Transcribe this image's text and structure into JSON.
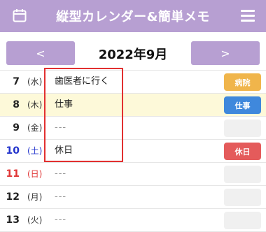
{
  "header": {
    "title": "縦型カレンダー&簡単メモ"
  },
  "nav": {
    "prev_label": "<",
    "next_label": ">",
    "month": "2022年9月"
  },
  "rows": [
    {
      "day": "7",
      "weekday": "(水)",
      "memo": "歯医者に行く",
      "tag": "病院",
      "tag_color": "#f0b54b"
    },
    {
      "day": "8",
      "weekday": "(木)",
      "memo": "仕事",
      "tag": "仕事",
      "tag_color": "#3f88dc"
    },
    {
      "day": "9",
      "weekday": "(金)",
      "memo": "---",
      "tag": "",
      "tag_color": ""
    },
    {
      "day": "10",
      "weekday": "(土)",
      "memo": "休日",
      "tag": "休日",
      "tag_color": "#e45b5b"
    },
    {
      "day": "11",
      "weekday": "(日)",
      "memo": "---",
      "tag": "",
      "tag_color": ""
    },
    {
      "day": "12",
      "weekday": "(月)",
      "memo": "---",
      "tag": "",
      "tag_color": ""
    },
    {
      "day": "13",
      "weekday": "(火)",
      "memo": "---",
      "tag": "",
      "tag_color": ""
    }
  ],
  "colors": {
    "accent": "#b79fd2",
    "today_bg": "#fdf9d9",
    "saturday": "#2233cc",
    "sunday": "#e03535",
    "highlight": "#e23030"
  },
  "icons": {
    "left": "calendar-icon",
    "right": "hamburger-menu-icon"
  }
}
